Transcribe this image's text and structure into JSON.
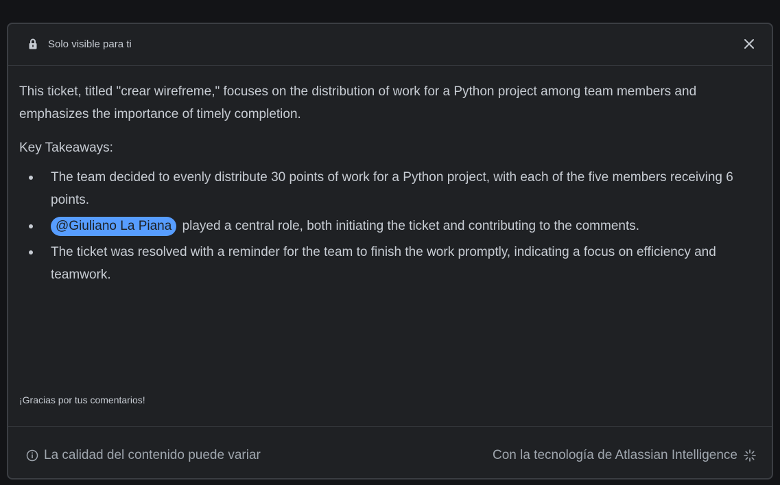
{
  "header": {
    "title": "Solo visible para ti",
    "lock_icon": "lock-icon",
    "close_icon": "close-icon"
  },
  "summary": {
    "intro": "This ticket, titled \"crear wirefreme,\" focuses on the distribution of work for a Python project among team members and emphasizes the importance of timely completion.",
    "subhead": "Key Takeaways:",
    "takeaways": [
      {
        "text": "The team decided to evenly distribute 30 points of work for a Python project, with each of the five members receiving 6 points."
      },
      {
        "mention": "@Giuliano La Piana",
        "text": "played a central role, both initiating the ticket and contributing to the comments."
      },
      {
        "text": "The ticket was resolved with a reminder for the team to finish the work promptly, indicating a focus on efficiency and teamwork."
      }
    ],
    "feedback": "¡Gracias por tus comentarios!"
  },
  "footer": {
    "disclaimer": "La calidad del contenido puede variar",
    "powered_by": "Con la tecnología de Atlassian Intelligence",
    "info_icon": "info-icon",
    "sparkle_icon": "sparkle-icon"
  },
  "colors": {
    "background": "#1f2124",
    "text": "#c7ccd3",
    "muted": "#9fa6ae",
    "mention_bg": "#579dff"
  }
}
